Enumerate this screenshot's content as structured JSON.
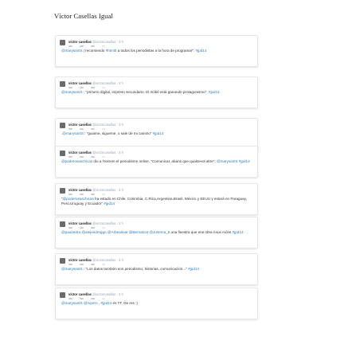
{
  "document": {
    "title": "Víctor Casellas Igual"
  },
  "tweets": [
    {
      "name": "víctor casellas",
      "handle": "@victorcasellas",
      "time": "3 h",
      "segments": [
        {
          "t": "@marysantS",
          "c": "blue"
        },
        {
          "t": " ¡'recomiendo ",
          "c": ""
        },
        {
          "t": "#html5",
          "c": "blue"
        },
        {
          "t": " a todos los periodistas a la hora de programar\". ",
          "c": ""
        },
        {
          "t": "#jpd14",
          "c": "blue"
        }
      ]
    },
    {
      "name": "víctor casellas",
      "handle": "@victorcasellas",
      "time": "3 h",
      "segments": [
        {
          "t": "@marysantS",
          "c": "blue"
        },
        {
          "t": " : \"primero digital, impreso secundario. El mòbil està ganando protagonismo\". ",
          "c": ""
        },
        {
          "t": "#jpd14",
          "c": "blue"
        }
      ]
    },
    {
      "name": "víctor casellas",
      "handle": "@victorcasellas",
      "time": "3 h",
      "segments": [
        {
          "t": ".@marysantS",
          "c": "blue"
        },
        {
          "t": " : \"guiame, sigueme, o sale de mi camino\" ",
          "c": ""
        },
        {
          "t": "#jpd14",
          "c": "blue"
        }
      ]
    },
    {
      "name": "víctor casellas",
      "handle": "@victorcasellas",
      "time": "3 h",
      "segments": [
        {
          "t": "@poderosaschicas",
          "c": "blue"
        },
        {
          "t": " diu a l'extrem el periodisme online. \"Comunicar, abans que qualsevol altre\", ",
          "c": ""
        },
        {
          "t": "@marysantS",
          "c": "blue"
        },
        {
          "t": " ",
          "c": ""
        },
        {
          "t": "#jpd14",
          "c": "blue"
        }
      ]
    },
    {
      "name": "víctor casellas",
      "handle": "@victorcasellas",
      "time": "2 h",
      "segments": [
        {
          "t": "\"",
          "c": ""
        },
        {
          "t": "@poderosaschicas",
          "c": "blue"
        },
        {
          "t": " ha estado en Chile, Colombia, C.Rica,Argentina,Brasil, México y EEUU y estará en Paraguay, Perú,Uruguay y Ecuador\" ",
          "c": ""
        },
        {
          "t": "#jpd14",
          "c": "blue"
        }
      ]
    },
    {
      "name": "víctor casellas",
      "handle": "@victorcasellas",
      "time": "2 h",
      "segments": [
        {
          "t": "@paubedra",
          "c": "blue"
        },
        {
          "t": " ",
          "c": ""
        },
        {
          "t": "@alejandroggo",
          "c": "blue"
        },
        {
          "t": " ",
          "c": ""
        },
        {
          "t": "@Arbeaitoat",
          "c": "blue"
        },
        {
          "t": " ",
          "c": ""
        },
        {
          "t": "@Bernatcat",
          "c": "blue"
        },
        {
          "t": " ",
          "c": ""
        },
        {
          "t": "@Josema_8",
          "c": "blue"
        },
        {
          "t": " una finestra que ens obra nous móns ",
          "c": ""
        },
        {
          "t": "#jpd14",
          "c": "blue"
        }
      ]
    },
    {
      "name": "víctor casellas",
      "handle": "@victorcasellas",
      "time": "2 h",
      "segments": [
        {
          "t": "@marysantS",
          "c": "blue"
        },
        {
          "t": " : \"Los datos también son periodismo, historias, comunicación...\" ",
          "c": ""
        },
        {
          "t": "#jpd14",
          "c": "blue"
        }
      ]
    },
    {
      "name": "víctor casellas",
      "handle": "@victorcasellas",
      "time": "2 h",
      "segments": [
        {
          "t": "@marysantS",
          "c": "blue"
        },
        {
          "t": " ",
          "c": ""
        },
        {
          "t": "@rvpero",
          "c": "blue"
        },
        {
          "t": " , ",
          "c": ""
        },
        {
          "t": "#jpd14",
          "c": "blue"
        },
        {
          "t": " és TT. De res :)",
          "c": ""
        }
      ]
    }
  ]
}
